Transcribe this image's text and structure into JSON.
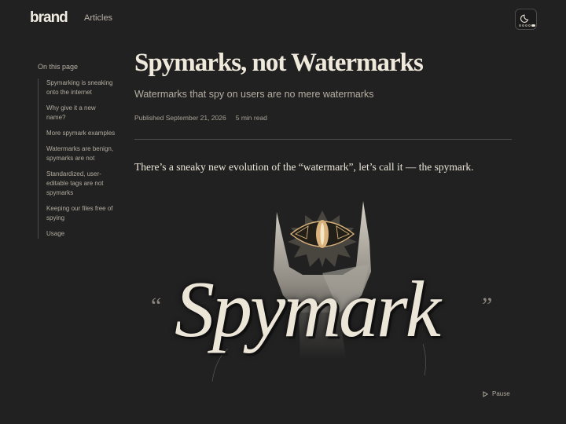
{
  "header": {
    "brand": "brand",
    "nav_articles": "Articles",
    "theme_icon": "moon-icon"
  },
  "toc": {
    "title": "On this page",
    "items": [
      {
        "label": "Spymarking is sneaking onto the internet"
      },
      {
        "label": "Why give it a new name?"
      },
      {
        "label": "More spymark examples"
      },
      {
        "label": "Watermarks are benign, spymarks are not"
      },
      {
        "label": "Standardized, user-editable tags are not spymarks"
      },
      {
        "label": "Keeping our files free of spying"
      },
      {
        "label": "Usage"
      }
    ]
  },
  "article": {
    "title": "Spymarks, not Watermarks",
    "subtitle": "Watermarks that spy on users are no mere watermarks",
    "published": "Published September 21, 2026",
    "read_time": "5 min read",
    "lede": "There’s a sneaky new evolution of the “watermark”, let’s call it — the spymark."
  },
  "hero": {
    "word": "Spymark",
    "quote_open": "“",
    "quote_close": "”",
    "pause_label": "Pause"
  },
  "colors": {
    "background": "#212121",
    "text": "#e9e3d6",
    "muted": "#b2ac9f",
    "accent_eye": "#d9b27c"
  }
}
